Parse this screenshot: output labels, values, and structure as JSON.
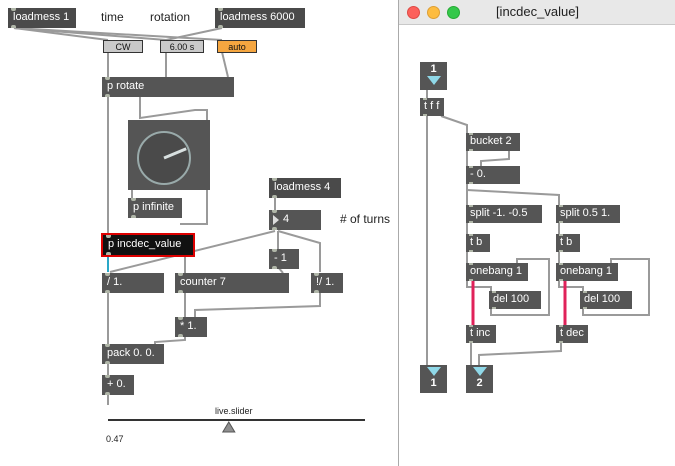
{
  "main_patcher": {
    "objects": {
      "loadmess1": "loadmess 1",
      "loadmess6000": "loadmess 6000",
      "protate": "p rotate",
      "pinfinite": "p infinite",
      "loadmess4": "loadmess 4",
      "pincdec": "p incdec_value",
      "div": "/ 1.",
      "counter": "counter 7",
      "minus": "- 1",
      "idiv": "!/ 1.",
      "mul": "* 1.",
      "pack": "pack 0. 0.",
      "plus": "+ 0."
    },
    "comments": {
      "time": "time",
      "rotation": "rotation",
      "turns": "# of turns"
    },
    "menus": {
      "direction": "CW",
      "duration": "6.00 s",
      "mode": "auto"
    },
    "number_box": "4",
    "slider": {
      "label": "live.slider",
      "value": 0.47,
      "value_text": "0.47"
    },
    "dial_value": 0.75,
    "colors": {
      "object": "#555555",
      "orange_menu": "#f5a640",
      "selection": "#dd0000"
    }
  },
  "subpatcher_window": {
    "title": "[incdec_value]",
    "inlet1": "1",
    "outlet1": "1",
    "outlet2": "2",
    "objects": {
      "tff": "t f f",
      "bucket": "bucket 2",
      "minus0": "- 0.",
      "split1": "split -1. -0.5",
      "split2": "split 0.5 1.",
      "tb1": "t b",
      "tb2": "t b",
      "onebang1": "onebang 1",
      "onebang2": "onebang 1",
      "del1": "del 100",
      "del2": "del 100",
      "tinc": "t inc",
      "tdec": "t dec"
    },
    "colors": {
      "close": "#fc605b",
      "minimize": "#fdbc40",
      "maximize": "#34c84a",
      "bang_cord": "#e0225a"
    }
  }
}
